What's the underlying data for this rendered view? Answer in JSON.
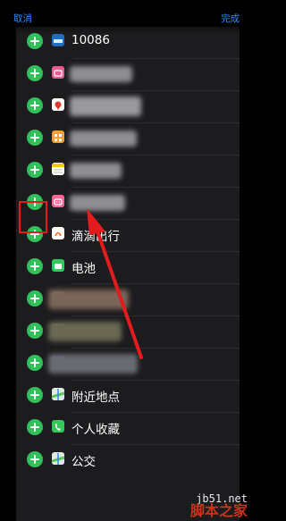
{
  "topbar": {
    "cancel_label": "取消",
    "done_label": "完成"
  },
  "widgets": [
    {
      "label": "10086",
      "icon": "mobile-10086-icon",
      "color": "#1b6ec2"
    },
    {
      "label": "",
      "icon": "bilibili-tv-icon",
      "color": "#e85c92"
    },
    {
      "label": "",
      "icon": "map-pin-icon",
      "color": "#ffffff"
    },
    {
      "label": "",
      "icon": "grid-app-icon",
      "color": "#f1a03c"
    },
    {
      "label": "",
      "icon": "notes-icon",
      "color": "#f5c518"
    },
    {
      "label": "",
      "icon": "bilibili-icon",
      "color": "#ff6699"
    },
    {
      "label": "滴滴出行",
      "icon": "didi-icon",
      "color": "#ffffff"
    },
    {
      "label": "电池",
      "icon": "battery-icon",
      "color": "#34c759"
    },
    {
      "label": "",
      "icon": "blurred-app-icon",
      "color": "#8a6a55"
    },
    {
      "label": "",
      "icon": "blurred-app-icon",
      "color": "#6b6a4a"
    },
    {
      "label": "",
      "icon": "blurred-app-icon",
      "color": "#4a4a5a"
    },
    {
      "label": "附近地点",
      "icon": "maps-icon",
      "color": "#5fc45a"
    },
    {
      "label": "个人收藏",
      "icon": "phone-icon",
      "color": "#34c759"
    },
    {
      "label": "公交",
      "icon": "transit-maps-icon",
      "color": "#5fc45a"
    }
  ],
  "watermark": {
    "url": "jb51.net",
    "name": "脚本之家"
  }
}
